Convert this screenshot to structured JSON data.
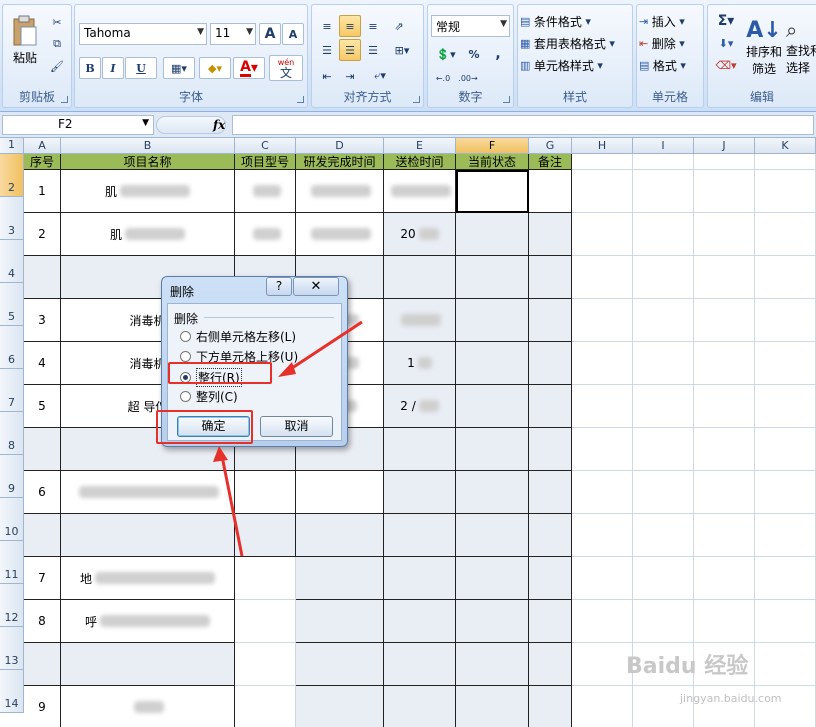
{
  "ribbon": {
    "clipboard": {
      "paste_label": "粘贴",
      "group_label": "剪贴板"
    },
    "font": {
      "font_name": "Tahoma",
      "font_size": "11",
      "grow": "A",
      "shrink": "A",
      "bold": "B",
      "italic": "I",
      "underline": "U",
      "font_color": "A",
      "wen": "wén",
      "wen2": "文",
      "group_label": "字体"
    },
    "alignment": {
      "group_label": "对齐方式"
    },
    "number": {
      "format": "常规",
      "percent": "%",
      "comma": ",",
      "group_label": "数字"
    },
    "styles": {
      "conditional": "条件格式",
      "table": "套用表格格式",
      "cell_styles": "单元格样式",
      "group_label": "样式"
    },
    "cells": {
      "insert": "插入",
      "delete": "删除",
      "format": "格式",
      "group_label": "单元格"
    },
    "editing": {
      "sigma": "Σ",
      "sort_l1": "排序和",
      "sort_l2": "筛选",
      "find_l1": "查找和",
      "find_l2": "选择",
      "group_label": "编辑"
    }
  },
  "formula_bar": {
    "name_box": "F2",
    "fx": "fx",
    "value": ""
  },
  "columns": [
    "A",
    "B",
    "C",
    "D",
    "E",
    "F",
    "G",
    "H",
    "I",
    "J",
    "K"
  ],
  "header_row": [
    "序号",
    "项目名称",
    "项目型号",
    "研发完成时间",
    "送检时间",
    "当前状态",
    "备注"
  ],
  "rows": [
    "1",
    "2",
    "3",
    "4",
    "5",
    "6",
    "7",
    "8",
    "9",
    "10",
    "11",
    "12",
    "13",
    "14"
  ],
  "data_rows": [
    {
      "num": "1",
      "name": "肌",
      "model": "",
      "done": "",
      "test": ""
    },
    {
      "num": "2",
      "name": "肌",
      "model": "",
      "done": "",
      "test": "20"
    },
    {
      "num": "",
      "name": "",
      "model": "",
      "done": "",
      "test": ""
    },
    {
      "num": "3",
      "name": "消毒机",
      "model": "",
      "done": "5/",
      "test": ""
    },
    {
      "num": "4",
      "name": "消毒机",
      "model": "",
      "done": "5/",
      "test": "1"
    },
    {
      "num": "5",
      "name": "超 导仪",
      "model": "",
      "done": "5",
      "test": "2 /"
    },
    {
      "num": "",
      "name": "",
      "model": "",
      "done": "",
      "test": ""
    },
    {
      "num": "6",
      "name": "",
      "model": "",
      "done": "",
      "test": ""
    },
    {
      "num": "",
      "name": "",
      "model": "",
      "done": "",
      "test": ""
    },
    {
      "num": "7",
      "name": "地",
      "model": "",
      "done": "",
      "test": ""
    },
    {
      "num": "8",
      "name": "呼",
      "model": "",
      "done": "",
      "test": ""
    },
    {
      "num": "",
      "name": "",
      "model": "",
      "done": "",
      "test": ""
    },
    {
      "num": "9",
      "name": "",
      "model": "",
      "done": "",
      "test": ""
    }
  ],
  "dialog": {
    "title": "删除",
    "help": "?",
    "close": "✕",
    "section": "删除",
    "options": [
      "右侧单元格左移(L)",
      "下方单元格上移(U)",
      "整行(R)",
      "整列(C)"
    ],
    "selected_index": 2,
    "ok": "确定",
    "cancel": "取消"
  },
  "watermark": {
    "brand": "Baidu 经验",
    "url": "jingyan.baidu.com"
  },
  "colors": {
    "header_green": "#9bbb59",
    "annotation_red": "#e8302a",
    "active_header": "#f1c15f"
  }
}
